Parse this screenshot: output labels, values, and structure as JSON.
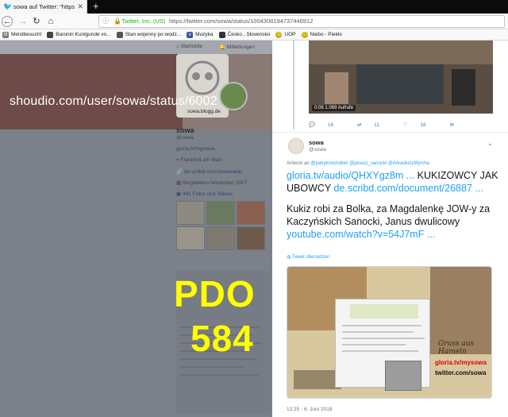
{
  "browser": {
    "tab_title": "sowa auf Twitter: \"https://t.co/",
    "owner": "Twitter, Inc. (US)",
    "url": "https://twitter.com/sowa/status/1004308194737446912",
    "bookmarks": [
      {
        "label": "Meistbesucht",
        "color": "#777777"
      },
      {
        "label": "Baronin Kunigunde vo...",
        "color": "#444444"
      },
      {
        "label": "Stan wojenny po wodz...",
        "color": "#555555"
      },
      {
        "label": "Muzyka",
        "color": "#3b5998"
      },
      {
        "label": "Česko , Slovensko",
        "color": "#333333"
      },
      {
        "label": "UOP",
        "color": "#c9b200"
      },
      {
        "label": "Niebo - Piekło",
        "color": "#c9b200"
      }
    ]
  },
  "left": {
    "nav": {
      "home": "Startseite",
      "notifications": "Mitteilungen"
    },
    "overlay_text": "shoudio.com/user/sowa/status/6002",
    "profile": {
      "name": "sowa",
      "handle": "@sowa",
      "site": "gloria.tv/mysowa",
      "location": "Frankfurt am Main",
      "link": "de.scribd.com/skowewski",
      "joined": "Beigetreten November 2007",
      "photos": "441 Fotos und Videos",
      "blog": "sowa.blogg.de"
    },
    "pdo_line1": "PDO",
    "pdo_line2": "584"
  },
  "right": {
    "video_caption": "0:08   1.069 Aufrufe",
    "actions": {
      "replies": "16",
      "retweets": "11",
      "likes": "18"
    },
    "tweet": {
      "name": "sowa",
      "handle": "@sowa",
      "reply_prefix": "Antwort an",
      "reply_to": "@patrykmichalski @janusz_sanocki @ArkadiuszMyrcha",
      "link1": "gloria.tv/audio/QHXYgz8m ...",
      "text1": " KUKIZOWCY JAK UBOWCY ",
      "link2": "de.scribd.com/document/26887 ...",
      "text2": "Kukiz robi za Bolka, za Magdalenkę JOW-y za Kaczyńskich Sanocki, Janus dwulicowy ",
      "link3": "youtube.com/watch?v=54J7mF ...",
      "translate": "Tweet übersetzen",
      "image_greeting": "Gruss aus Hameln",
      "image_tag1": "gloria.tv/mysowa",
      "image_tag2": "twitter.com/sowa",
      "timestamp": "12:25 - 6. Juni 2018"
    }
  },
  "colors": {
    "accent": "#1da1f2",
    "overlay_yellow": "#ffff00",
    "secure_green": "#12bc00"
  }
}
